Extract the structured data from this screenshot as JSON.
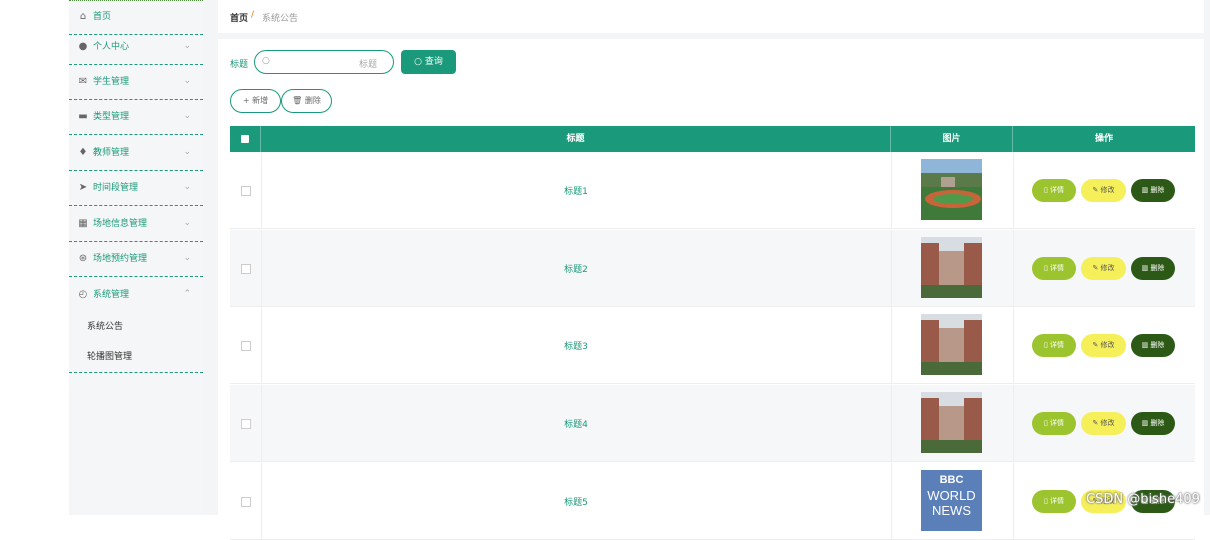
{
  "sidebar": {
    "items": [
      {
        "label": "首页",
        "icon": "home-icon",
        "glyph": "⌂",
        "chevron": ""
      },
      {
        "label": "个人中心",
        "icon": "user-icon",
        "glyph": "●",
        "chevron": "⌄"
      },
      {
        "label": "学生管理",
        "icon": "mail-icon",
        "glyph": "✉",
        "chevron": "⌄"
      },
      {
        "label": "类型管理",
        "icon": "briefcase-icon",
        "glyph": "▬",
        "chevron": "⌄"
      },
      {
        "label": "教师管理",
        "icon": "microphone-icon",
        "glyph": "♦",
        "chevron": "⌄"
      },
      {
        "label": "时间段管理",
        "icon": "send-icon",
        "glyph": "➤",
        "chevron": "⌄"
      },
      {
        "label": "场地信息管理",
        "icon": "grid-icon",
        "glyph": "▦",
        "chevron": "⌄"
      },
      {
        "label": "场地预约管理",
        "icon": "basketball-icon",
        "glyph": "⊛",
        "chevron": "⌄"
      },
      {
        "label": "系统管理",
        "icon": "dashboard-icon",
        "glyph": "◴",
        "chevron": "⌃"
      }
    ],
    "sub_items": [
      {
        "label": "系统公告"
      },
      {
        "label": "轮播图管理"
      }
    ]
  },
  "breadcrumb": {
    "home": "首页",
    "separator": "/",
    "current": "系统公告"
  },
  "search": {
    "label": "标题",
    "placeholder": "标题",
    "button": "查询"
  },
  "toolbar": {
    "add": "+ 新增",
    "delete": "删除"
  },
  "table": {
    "headers": {
      "title": "标题",
      "image": "图片",
      "actions": "操作"
    },
    "rows": [
      {
        "title": "标题1",
        "image": "sports-field-photo"
      },
      {
        "title": "标题2",
        "image": "school-building-photo"
      },
      {
        "title": "标题3",
        "image": "school-building-photo"
      },
      {
        "title": "标题4",
        "image": "school-building-photo"
      },
      {
        "title": "标题5",
        "image": "bbc-world-news-photo",
        "image_text_1": "BBC",
        "image_text_2": "WORLD",
        "image_text_3": "NEWS"
      }
    ],
    "row_actions": {
      "detail": "详情",
      "edit": "修改",
      "delete": "删除"
    }
  },
  "watermark": "CSDN @bishe409",
  "colors": {
    "primary": "#1a9a7a",
    "detail": "#9cc42e",
    "edit": "#f5ef5a",
    "delete": "#2c5a16"
  }
}
